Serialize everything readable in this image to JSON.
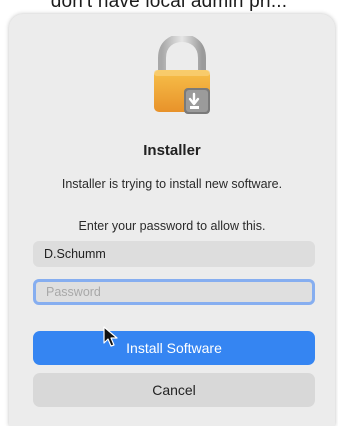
{
  "background_text": "don't have local admin pri...",
  "dialog": {
    "icon": "lock-icon",
    "title": "Installer",
    "message": "Installer is trying to install new software.",
    "prompt": "Enter your password to allow this.",
    "username_value": "D.Schumm",
    "password_placeholder": "Password",
    "primary_button_label": "Install Software",
    "secondary_button_label": "Cancel"
  },
  "colors": {
    "primary_button": "#3585f2",
    "focus_ring": "#86aef0",
    "dialog_background": "#ececec"
  }
}
